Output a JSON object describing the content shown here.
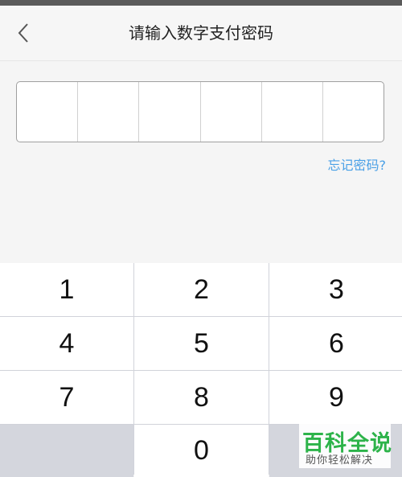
{
  "header": {
    "title": "请输入数字支付密码",
    "back_icon": "chevron-left-icon"
  },
  "pin": {
    "length": 6,
    "filled": 0
  },
  "forgot_link": "忘记密码?",
  "keypad": {
    "keys": [
      "1",
      "2",
      "3",
      "4",
      "5",
      "6",
      "7",
      "8",
      "9",
      "",
      "0",
      ""
    ]
  },
  "watermark": {
    "logo": "百科全说",
    "subtitle": "助你轻松解决"
  },
  "colors": {
    "accent_link": "#4aa0e6",
    "watermark_green": "#2db34a",
    "keypad_gap": "#d1d3da"
  }
}
